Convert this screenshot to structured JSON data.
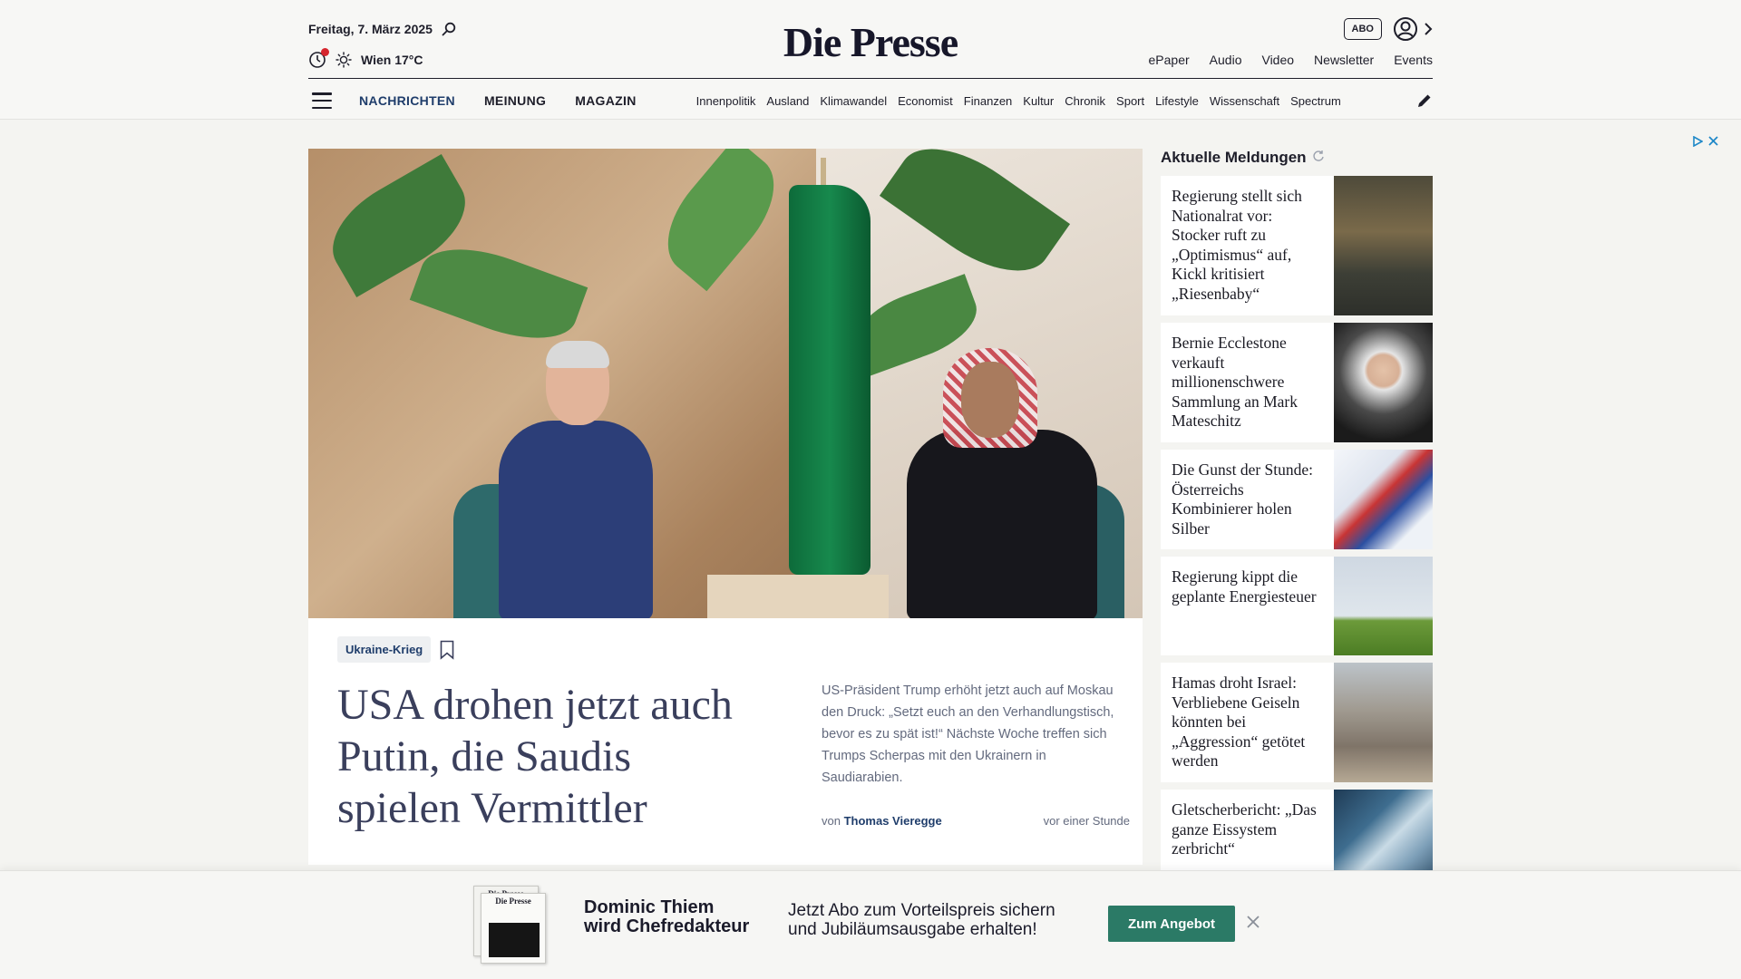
{
  "header": {
    "date": "Freitag, 7. März 2025",
    "weather": "Wien 17°C",
    "logo": "Die Presse",
    "abo_label": "ABO",
    "util_links": [
      "ePaper",
      "Audio",
      "Video",
      "Newsletter",
      "Events"
    ],
    "main_nav": [
      "NACHRICHTEN",
      "MEINUNG",
      "MAGAZIN"
    ],
    "sub_nav": [
      "Innenpolitik",
      "Ausland",
      "Klimawandel",
      "Economist",
      "Finanzen",
      "Kultur",
      "Chronik",
      "Sport",
      "Lifestyle",
      "Wissenschaft",
      "Spectrum"
    ]
  },
  "hero": {
    "tag": "Ukraine-Krieg",
    "headline": "USA drohen jetzt auch Putin, die Saudis spielen Vermittler",
    "teaser": "US-Präsident Trump erhöht jetzt auch auf Moskau den Druck: „Setzt euch an den Verhandlungstisch, bevor es zu spät ist!“ Nächste Woche treffen sich Trumps Scherpas mit den Ukrainern in Saudiarabien.",
    "byline_prefix": "von",
    "author": "Thomas Vieregge",
    "time": "vor einer Stunde"
  },
  "sidebar": {
    "title": "Aktuelle Meldungen",
    "items": [
      {
        "text": "Regierung stellt sich Nationalrat vor: Stocker ruft zu „Optimismus“ auf, Kickl kritisiert „Riesenbaby“",
        "thumb": "parliament"
      },
      {
        "text": "Bernie Ecclestone verkauft millionenschwere Sammlung an Mark Mateschitz",
        "thumb": "portrait"
      },
      {
        "text": "Die Gunst der Stunde: Österreichs Kombinierer holen Silber",
        "thumb": "ski"
      },
      {
        "text": "Regierung kippt die geplante Energiesteuer",
        "thumb": "powerlines"
      },
      {
        "text": "Hamas droht Israel: Verbliebene Geiseln könnten bei „Aggression“ getötet werden",
        "thumb": "ruins"
      },
      {
        "text": "Gletscherbericht: „Das ganze Eissystem zerbricht“",
        "thumb": "glacier"
      }
    ]
  },
  "promo": {
    "paper_mast": "Die Presse",
    "title_line1": "Dominic Thiem",
    "title_line2": "wird Chefredakteur",
    "text_line1": "Jetzt Abo zum Vorteilspreis sichern",
    "text_line2": "und Jubiläumsausgabe erhalten!",
    "button": "Zum Angebot"
  },
  "colors": {
    "brand_navy": "#1f3d6b",
    "promo_green": "#2b7a66",
    "alert_red": "#d6262e"
  }
}
